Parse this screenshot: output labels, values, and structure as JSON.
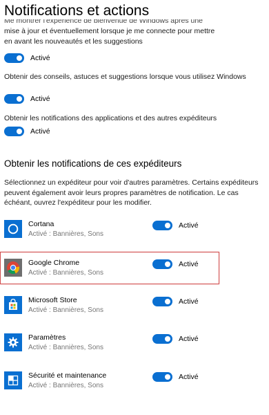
{
  "page_title": "Notifications et actions",
  "intro_clipped": {
    "line1": "Me montrer l'expérience de bienvenue de Windows après une",
    "line2": "mise à jour et éventuellement lorsque je me connecte pour mettre",
    "line3": "en avant les nouveautés et les suggestions",
    "toggle_label": "Activé"
  },
  "settings": [
    {
      "text": "Obtenir des conseils, astuces et suggestions lorsque vous utilisez Windows",
      "toggle_label": "Activé"
    },
    {
      "text": "Obtenir les notifications des applications et des autres expéditeurs",
      "toggle_label": "Activé"
    }
  ],
  "senders_section": {
    "heading": "Obtenir les notifications de ces expéditeurs",
    "description": "Sélectionnez un expéditeur pour voir d'autres paramètres. Certains expéditeurs peuvent également avoir leurs propres paramètres de notification. Le cas échéant, ouvrez l'expéditeur pour les modifier."
  },
  "apps": [
    {
      "name": "Cortana",
      "subtitle": "Activé : Bannières, Sons",
      "toggle_label": "Activé",
      "icon": "cortana-icon"
    },
    {
      "name": "Google Chrome",
      "subtitle": "Activé : Bannières, Sons",
      "toggle_label": "Activé",
      "icon": "chrome-icon"
    },
    {
      "name": "Microsoft Store",
      "subtitle": "Activé : Bannières, Sons",
      "toggle_label": "Activé",
      "icon": "store-icon"
    },
    {
      "name": "Paramètres",
      "subtitle": "Activé : Bannières, Sons",
      "toggle_label": "Activé",
      "icon": "gear-icon"
    },
    {
      "name": "Sécurité et maintenance",
      "subtitle": "Activé : Bannières, Sons",
      "toggle_label": "Activé",
      "icon": "security-maintenance-icon"
    }
  ],
  "colors": {
    "accent": "#0a6fd1",
    "highlight_border": "#d14b4b",
    "subtitle_gray": "#767676"
  }
}
